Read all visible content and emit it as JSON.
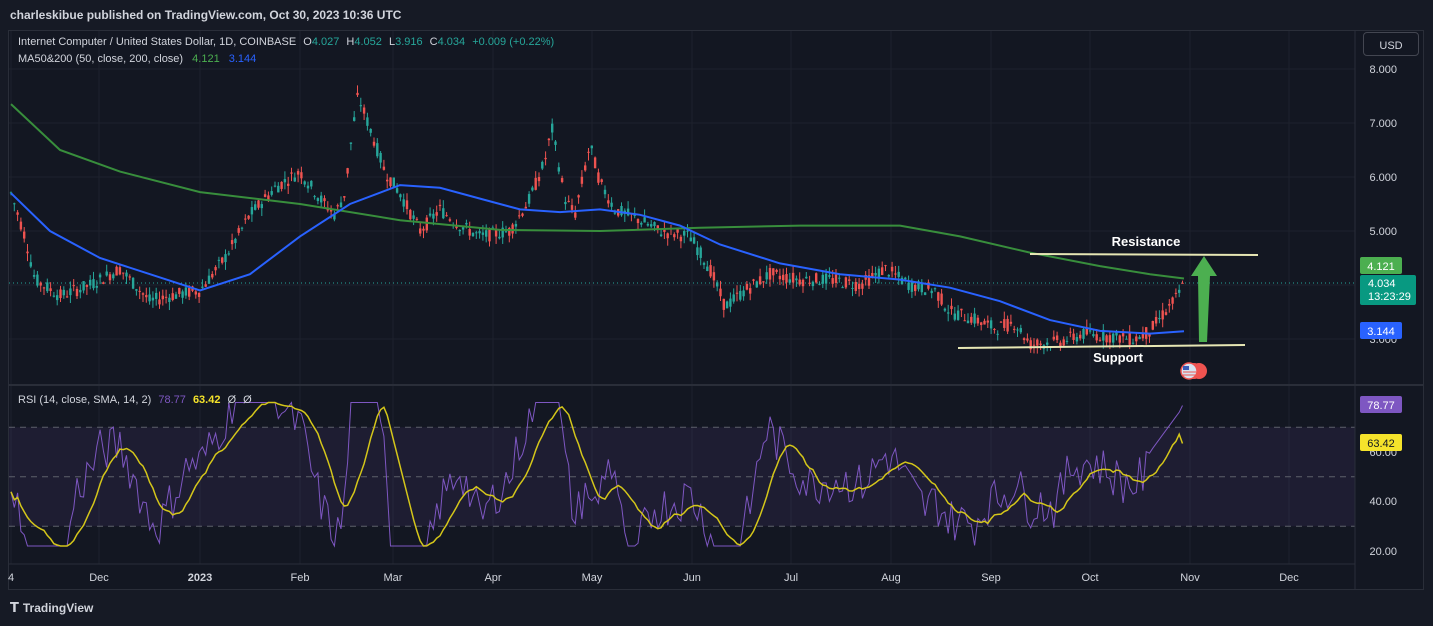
{
  "header": {
    "published": "charleskibue published on TradingView.com, Oct 30, 2023 10:36 UTC"
  },
  "symbol": {
    "name": "Internet Computer / United States Dollar, 1D, COINBASE",
    "o_label": "O",
    "o": "4.027",
    "h_label": "H",
    "h": "4.052",
    "l_label": "L",
    "l": "3.916",
    "c_label": "C",
    "c": "4.034",
    "change": "+0.009 (+0.22%)"
  },
  "ma": {
    "label": "MA50&200 (50, close, 200, close)",
    "ma200_value": "4.121",
    "ma50_value": "3.144"
  },
  "rsi": {
    "label": "RSI (14, close, SMA, 14, 2)",
    "rsi_value": "78.77",
    "sma_value": "63.42",
    "extra1": "Ø",
    "extra2": "Ø"
  },
  "currency_button": "USD",
  "price_axis": [
    "8.000",
    "7.000",
    "6.000",
    "5.000",
    "3.000"
  ],
  "rsi_axis": [
    "60.00",
    "40.00",
    "20.00"
  ],
  "time_axis": [
    "4",
    "Dec",
    "2023",
    "Feb",
    "Mar",
    "Apr",
    "May",
    "Jun",
    "Jul",
    "Aug",
    "Sep",
    "Oct",
    "Nov",
    "Dec"
  ],
  "badges": {
    "ma200": "4.121",
    "price": "4.034",
    "countdown": "13:23:29",
    "ma50": "3.144",
    "rsi": "78.77",
    "rsi_sma": "63.42"
  },
  "annotations": {
    "resistance": "Resistance",
    "support": "Support"
  },
  "footer": {
    "brand": "TradingView"
  },
  "colors": {
    "background": "#131722",
    "up": "#26a69a",
    "down": "#ef5350",
    "ma50": "#2962ff",
    "ma200": "#388e3c",
    "rsi": "#7e57c2",
    "rsi_sma": "#d4c61a",
    "arrow": "#4caf50",
    "level_line": "#e6e6b4"
  }
}
